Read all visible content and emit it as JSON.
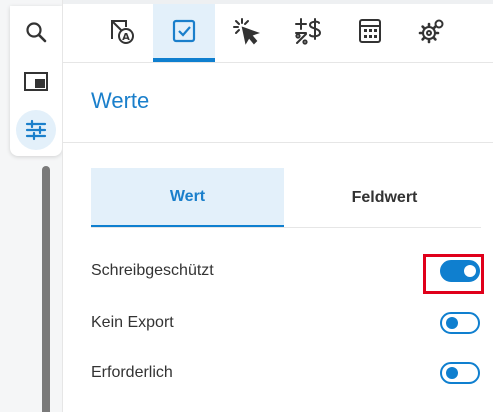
{
  "rail": {
    "items": [
      {
        "icon": "search-icon"
      },
      {
        "icon": "window-icon"
      },
      {
        "icon": "sliders-icon",
        "active": true
      }
    ]
  },
  "toolbar": {
    "tools": [
      {
        "icon": "format-icon"
      },
      {
        "icon": "checkbox-icon",
        "active": true
      },
      {
        "icon": "cursor-click-icon"
      },
      {
        "icon": "plus-minus-percent-icon"
      },
      {
        "icon": "calculator-icon"
      },
      {
        "icon": "settings-icon"
      }
    ]
  },
  "panel": {
    "title": "Werte",
    "tabs": [
      {
        "label": "Wert",
        "active": true
      },
      {
        "label": "Feldwert",
        "active": false
      }
    ],
    "rows": [
      {
        "label": "Schreibgeschützt",
        "state": "on"
      },
      {
        "label": "Kein Export",
        "state": "off"
      },
      {
        "label": "Erforderlich",
        "state": "off"
      }
    ]
  },
  "colors": {
    "accent": "#0f7fcf",
    "highlight": "#e0001b",
    "active_bg": "#e3f0fa"
  }
}
